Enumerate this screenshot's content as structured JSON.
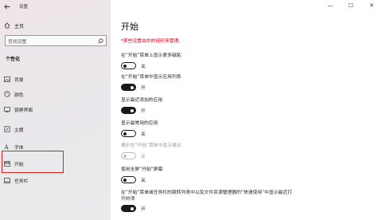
{
  "app": {
    "title": "设置"
  },
  "sidebar": {
    "home_label": "主页",
    "search_placeholder": "查找设置",
    "section_title": "个性化",
    "items": [
      {
        "label": "背景",
        "icon": "image-icon"
      },
      {
        "label": "颜色",
        "icon": "palette-icon"
      },
      {
        "label": "锁屏界面",
        "icon": "lock-screen-icon"
      },
      {
        "label": "主题",
        "icon": "theme-icon"
      },
      {
        "label": "字体",
        "icon": "font-icon"
      },
      {
        "label": "开始",
        "icon": "start-icon"
      },
      {
        "label": "任务栏",
        "icon": "taskbar-icon"
      }
    ]
  },
  "window": {
    "minimize": "—",
    "maximize": "☐",
    "close": "✕"
  },
  "main": {
    "title": "开始",
    "managed_note": "*某些设置由你的组织来管理。",
    "settings": [
      {
        "label": "在“开始”菜单上显示更多磁贴",
        "state": "关",
        "on": false,
        "disabled": false
      },
      {
        "label": "在“开始”菜单中显示应用列表",
        "state": "开",
        "on": true,
        "disabled": false
      },
      {
        "label": "显示最近添加的应用",
        "state": "开",
        "on": true,
        "disabled": false
      },
      {
        "label": "显示最常用的应用",
        "state": "关",
        "on": false,
        "disabled": false
      },
      {
        "label": "偶尔在“开始”菜单中显示建议",
        "state": "关",
        "on": false,
        "disabled": true
      },
      {
        "label": "使用全屏“开始”屏幕",
        "state": "关",
        "on": false,
        "disabled": false
      },
      {
        "label": "在“开始”菜单或任务栏的跳转列表中以及文件资源管理器的“快速使用”中显示最近打开的项",
        "state": "开",
        "on": true,
        "disabled": false
      }
    ]
  },
  "colors": {
    "accent": "#1a1a1a",
    "highlight": "#e0211f",
    "warning": "#d0021b"
  }
}
